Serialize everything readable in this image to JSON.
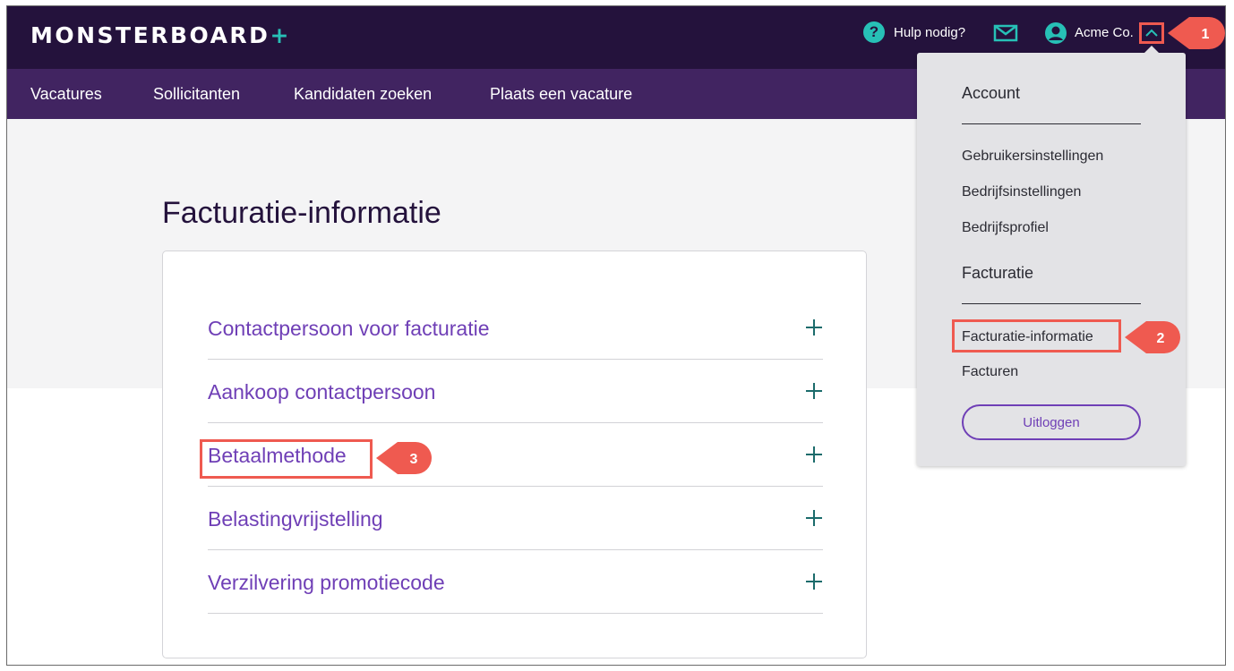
{
  "header": {
    "logo_text": "MONSTERBOARD",
    "logo_plus": "+",
    "help_label": "Hulp nodig?",
    "help_icon_glyph": "?",
    "account_name": "Acme Co."
  },
  "nav": {
    "items": [
      {
        "label": "Vacatures"
      },
      {
        "label": "Sollicitanten"
      },
      {
        "label": "Kandidaten zoeken"
      },
      {
        "label": "Plaats een vacature"
      }
    ]
  },
  "main": {
    "title": "Facturatie-informatie",
    "sections": [
      {
        "label": "Contactpersoon voor facturatie"
      },
      {
        "label": "Aankoop contactpersoon"
      },
      {
        "label": "Betaalmethode"
      },
      {
        "label": "Belastingvrijstelling"
      },
      {
        "label": "Verzilvering promotiecode"
      }
    ]
  },
  "dropdown": {
    "account_heading": "Account",
    "account_items": [
      {
        "label": "Gebruikersinstellingen"
      },
      {
        "label": "Bedrijfsinstellingen"
      },
      {
        "label": "Bedrijfsprofiel"
      }
    ],
    "billing_heading": "Facturatie",
    "billing_items": [
      {
        "label": "Facturatie-informatie"
      },
      {
        "label": "Facturen"
      }
    ],
    "logout_label": "Uitloggen"
  },
  "callouts": {
    "one": "1",
    "two": "2",
    "three": "3"
  },
  "colors": {
    "topbar": "#24123c",
    "navbar": "#412461",
    "accent_teal": "#27c0b6",
    "link_purple": "#6f3fb6",
    "annotation_red": "#ef5a50"
  }
}
